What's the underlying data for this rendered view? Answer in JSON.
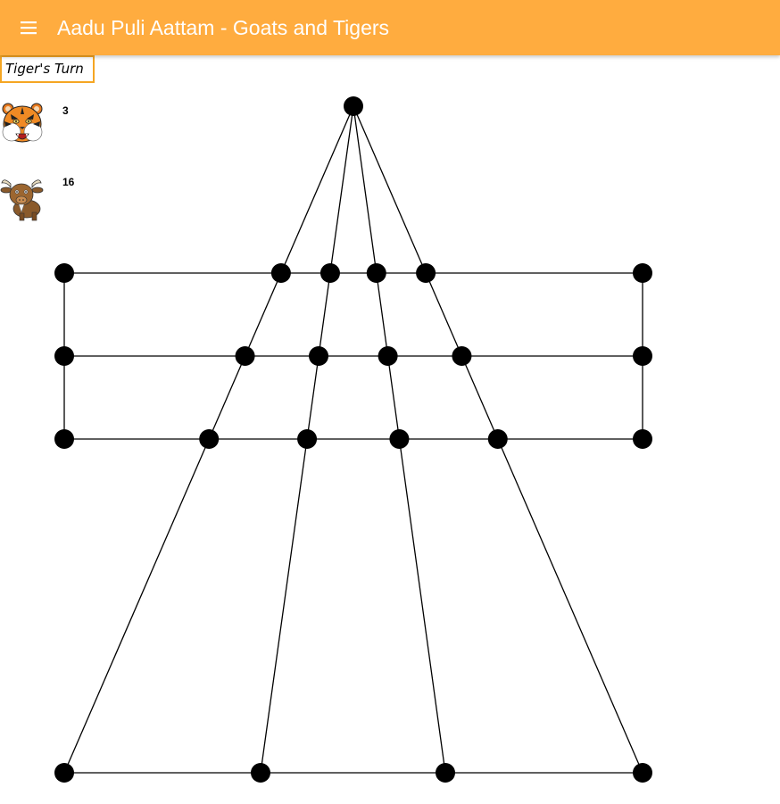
{
  "header": {
    "title": "Aadu Puli Aattam - Goats and Tigers",
    "menu_icon": "hamburger-menu-icon",
    "background": "#ffac3f",
    "text_color": "#ffffff"
  },
  "status": {
    "turn_label": "Tiger's Turn",
    "border_color": "#f5a623"
  },
  "counters": {
    "tiger": {
      "icon": "tiger-face-icon",
      "count": "3"
    },
    "goat": {
      "icon": "goat-icon",
      "count": "16"
    }
  },
  "board": {
    "node_color": "#000000",
    "line_color": "#000000"
  }
}
